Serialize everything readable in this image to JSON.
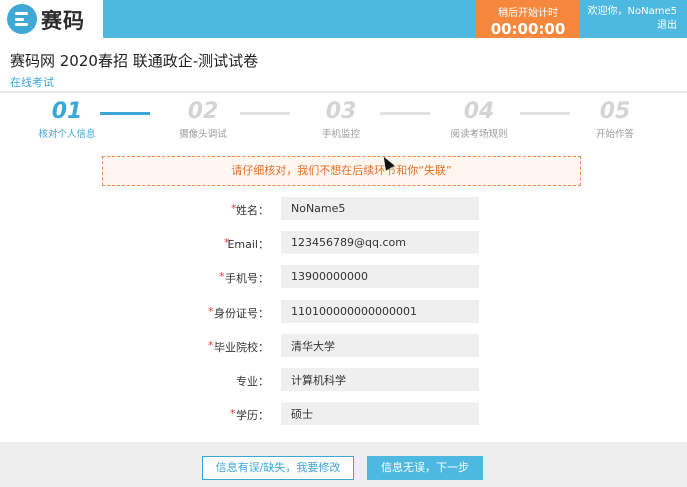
{
  "header": {
    "logo_text": "赛码",
    "timer_label": "稍后开始计时",
    "timer_value": "00:00:00",
    "welcome": "欢迎你，NoName5",
    "logout": "退出",
    "colors": {
      "bar": "#4db8e0",
      "timer": "#f5883d"
    }
  },
  "page": {
    "title": "赛码网 2020春招 联通政企-测试试卷",
    "subtitle": "在线考试"
  },
  "steps": [
    {
      "num": "01",
      "label": "核对个人信息",
      "active": true
    },
    {
      "num": "02",
      "label": "摄像头调试",
      "active": false
    },
    {
      "num": "03",
      "label": "手机监控",
      "active": false
    },
    {
      "num": "04",
      "label": "阅读考场规则",
      "active": false
    },
    {
      "num": "05",
      "label": "开始作答",
      "active": false
    }
  ],
  "notice": "请仔细核对，我们不想在后续环节和你“失联”",
  "form": {
    "name": {
      "label": "姓名：",
      "value": "NoName5",
      "required": true
    },
    "email": {
      "label": "Email：",
      "value": "123456789@qq.com",
      "required": true
    },
    "phone": {
      "label": "手机号：",
      "value": "13900000000",
      "required": true
    },
    "id_card": {
      "label": "身份证号：",
      "value": "110100000000000001",
      "required": true
    },
    "school": {
      "label": "毕业院校：",
      "value": "清华大学",
      "required": true
    },
    "major": {
      "label": "专业：",
      "value": "计算机科学",
      "required": false
    },
    "degree": {
      "label": "学历：",
      "value": "硕士",
      "required": true
    },
    "required_mark": "*"
  },
  "actions": {
    "edit": "信息有误/缺失，我要修改",
    "next": "信息无误，下一步"
  }
}
